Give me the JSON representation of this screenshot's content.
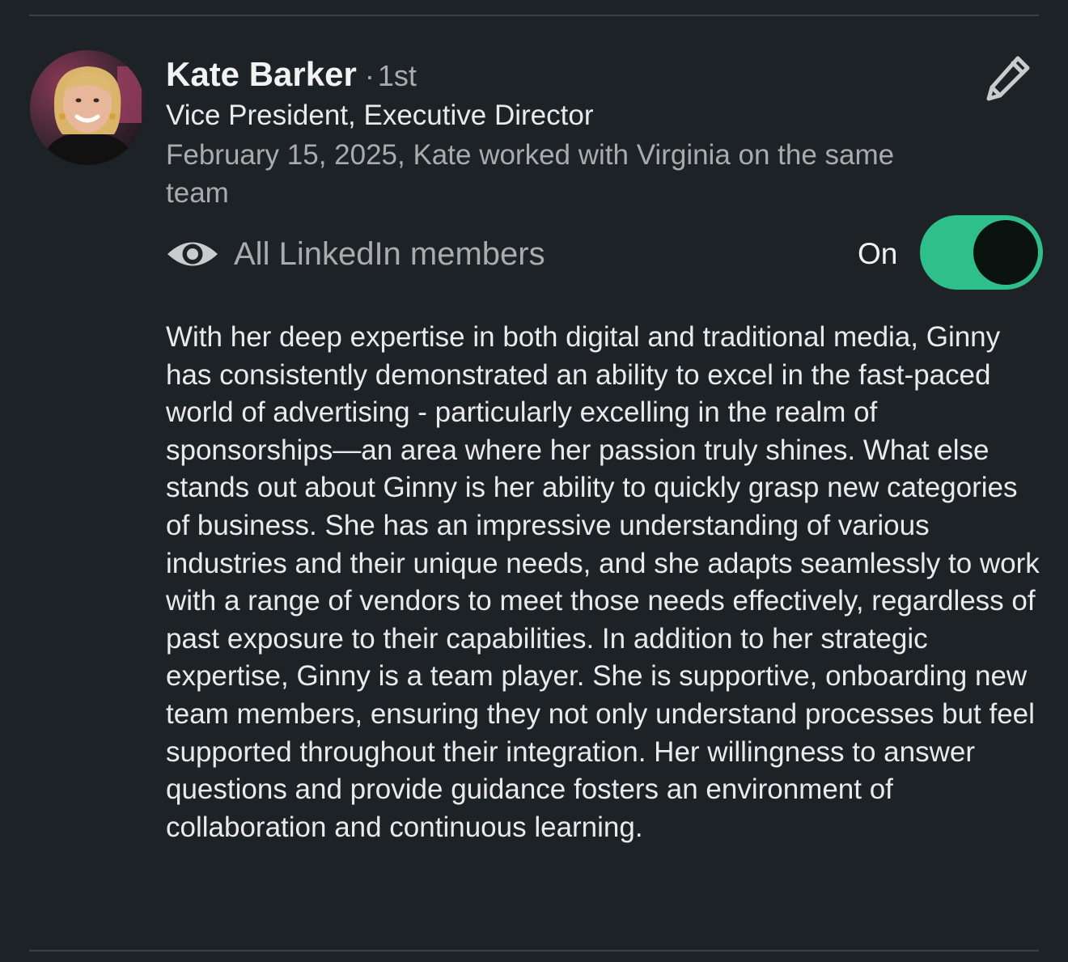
{
  "recommendation": {
    "author_name": "Kate Barker",
    "separator": "·",
    "connection_degree": "1st",
    "author_headline": "Vice President, Executive Director",
    "relationship_meta": "February 15, 2025, Kate worked with Virginia on the same team",
    "visibility": {
      "icon": "eye-icon",
      "label": "All LinkedIn members",
      "toggle_state_label": "On",
      "enabled": true
    },
    "edit_icon": "pencil-icon",
    "text": "With her deep expertise in both digital and traditional media, Ginny has consistently demonstrated an ability to excel in the fast-paced world of advertising - particularly excelling in the realm of sponsorships—an area where her passion truly shines. What else stands out about Ginny is her ability to quickly grasp new categories of business. She has an impressive understanding of various industries and their unique needs, and she adapts seamlessly to work with a range of vendors to meet those needs effectively, regardless of past exposure to their capabilities. In addition to her strategic expertise, Ginny is a team player. She is supportive, onboarding new team members, ensuring they not only understand processes but feel supported throughout their integration. Her willingness to answer questions and provide guidance fosters an environment of collaboration and continuous learning."
  },
  "colors": {
    "background": "#1d2226",
    "toggle_on": "#2fbf8b",
    "secondary_text": "#a8acaf"
  }
}
